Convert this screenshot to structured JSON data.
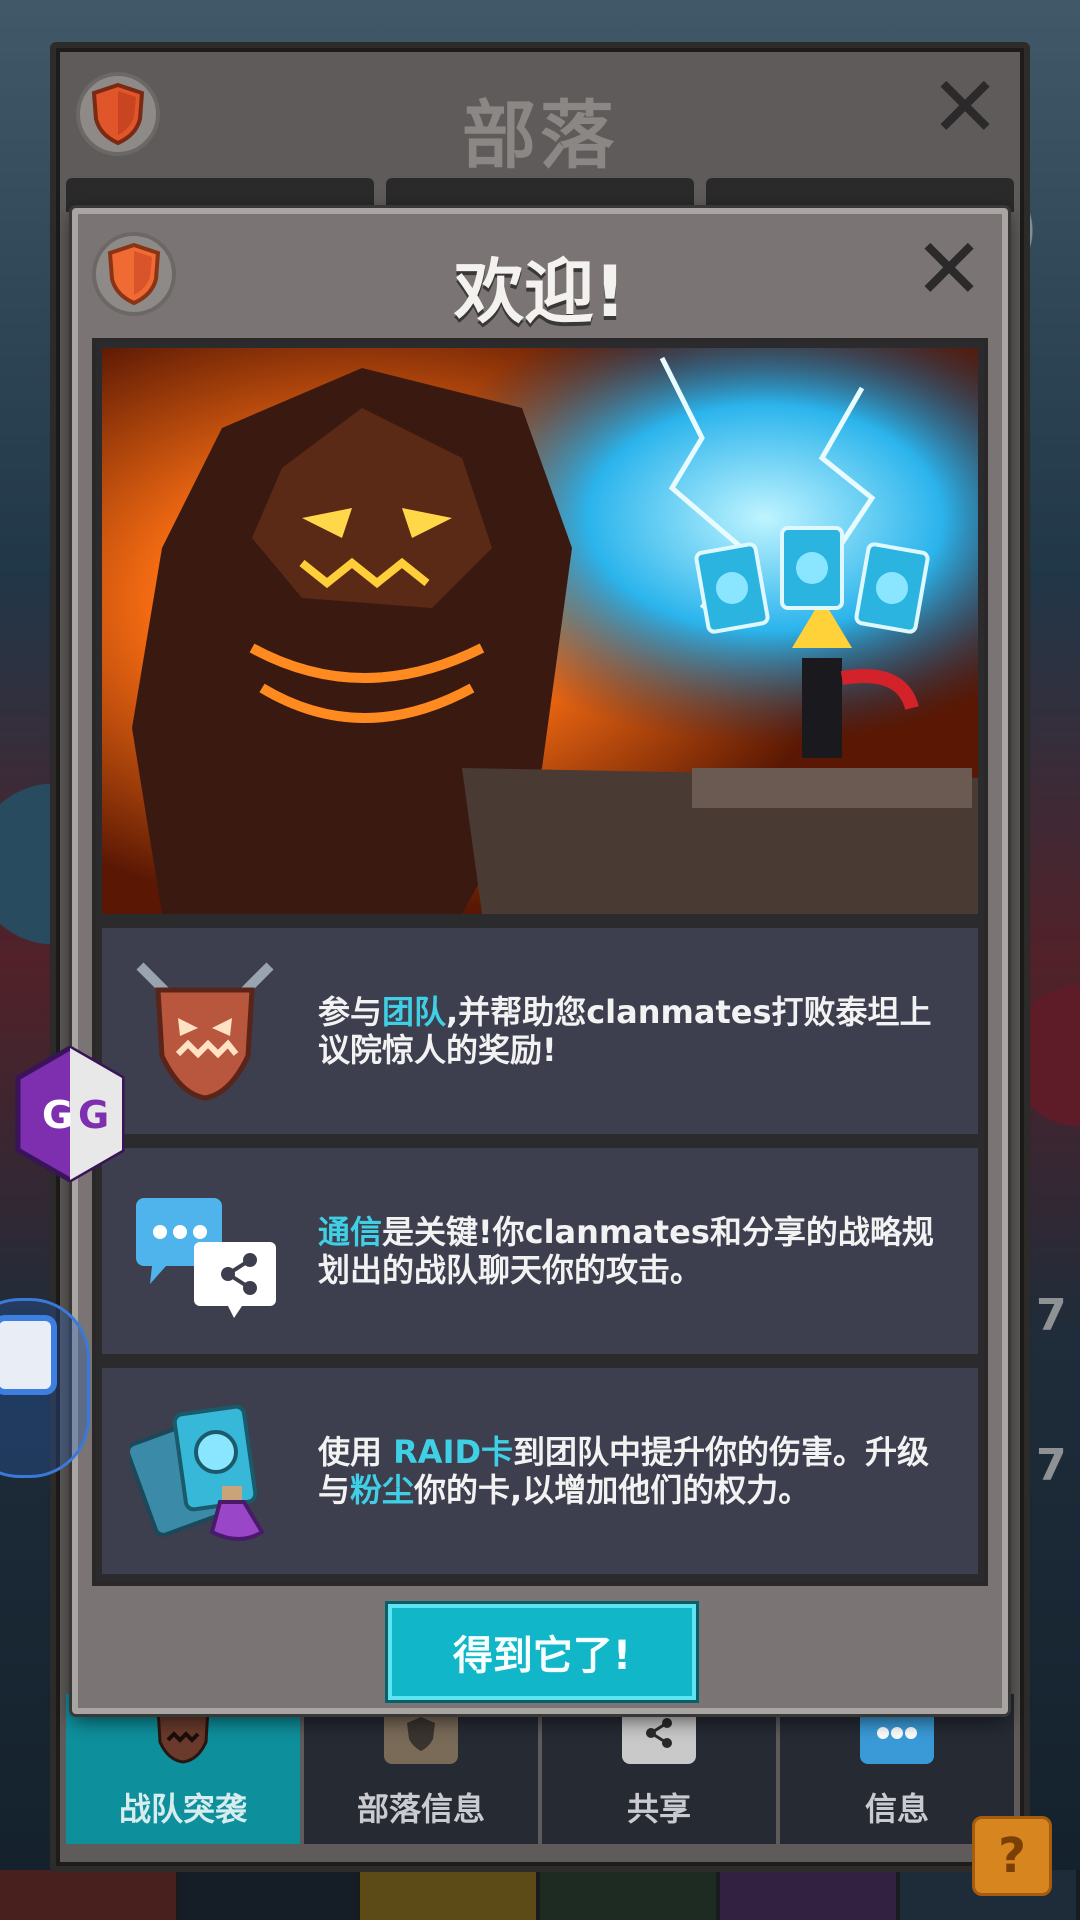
{
  "clan_panel": {
    "title": "部落",
    "nav": [
      {
        "label": "战队突袭",
        "icon": "raid-mask-icon",
        "active": true
      },
      {
        "label": "部落信息",
        "icon": "clan-info-icon",
        "active": false
      },
      {
        "label": "共享",
        "icon": "share-icon",
        "active": false
      },
      {
        "label": "信息",
        "icon": "chat-icon",
        "active": false
      }
    ]
  },
  "welcome": {
    "title": "欢迎!",
    "rows": [
      {
        "icon": "raid-mask-icon",
        "parts": [
          {
            "text": "参与",
            "hl": false
          },
          {
            "text": "团队",
            "hl": true
          },
          {
            "text": ",并帮助您clanmates打败泰坦上议院惊人的奖励!",
            "hl": false
          }
        ]
      },
      {
        "icon": "chat-share-icon",
        "parts": [
          {
            "text": "通信",
            "hl": true
          },
          {
            "text": "是关键!你clanmates和分享的战略规划出的战队聊天你的攻击。",
            "hl": false
          }
        ]
      },
      {
        "icon": "raid-card-potion-icon",
        "parts": [
          {
            "text": "使用 ",
            "hl": false
          },
          {
            "text": "RAID卡",
            "hl": true
          },
          {
            "text": "到团队中提升你的伤害。升级与",
            "hl": false
          },
          {
            "text": "粉尘",
            "hl": true
          },
          {
            "text": "你的卡,以增加他们的权力。",
            "hl": false
          }
        ]
      }
    ],
    "button_label": "得到它了!"
  },
  "overlays": {
    "gg_label": "GG",
    "help_label": "?"
  },
  "colors": {
    "highlight": "#3fd0e6",
    "button": "#11b6c9",
    "active_tab": "#0e8f9c"
  }
}
